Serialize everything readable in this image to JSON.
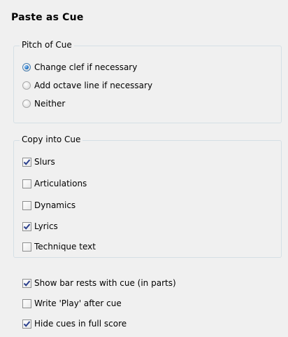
{
  "dialog": {
    "title": "Paste as Cue"
  },
  "pitch_group": {
    "legend": "Pitch of Cue",
    "options": [
      {
        "label": "Change clef if necessary",
        "selected": true
      },
      {
        "label": "Add octave line if necessary",
        "selected": false
      },
      {
        "label": "Neither",
        "selected": false
      }
    ]
  },
  "copy_group": {
    "legend": "Copy into Cue",
    "options": [
      {
        "label": "Slurs",
        "checked": true
      },
      {
        "label": "Articulations",
        "checked": false
      },
      {
        "label": "Dynamics",
        "checked": false
      },
      {
        "label": "Lyrics",
        "checked": true
      },
      {
        "label": "Technique text",
        "checked": false
      }
    ]
  },
  "extra_options": [
    {
      "label": "Show bar rests with cue (in parts)",
      "checked": true
    },
    {
      "label": "Write 'Play' after cue",
      "checked": false
    },
    {
      "label": "Hide cues in full score",
      "checked": true
    }
  ],
  "colors": {
    "check_mark": "#2a3f8c",
    "radio_dot": "#1f6fc0",
    "group_border": "#d5dfe5"
  }
}
